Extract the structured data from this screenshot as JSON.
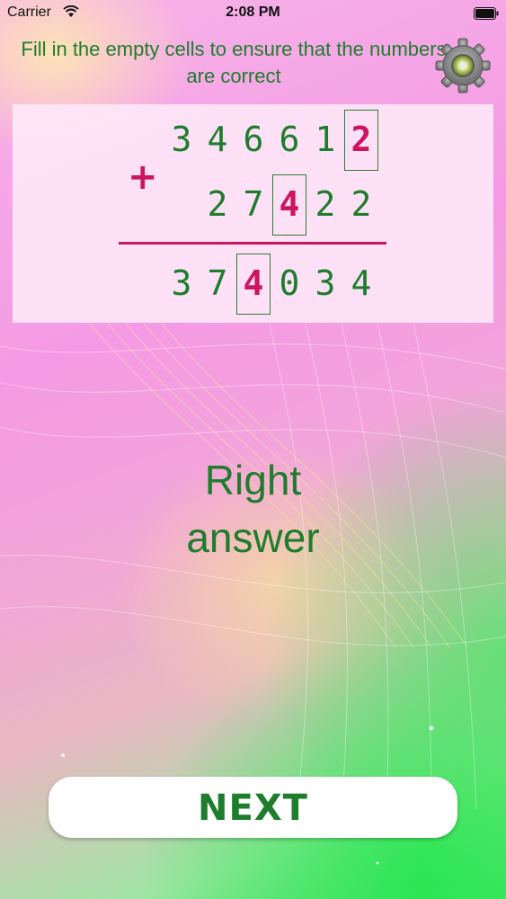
{
  "status_bar": {
    "carrier": "Carrier",
    "time": "2:08 PM",
    "icons": [
      "wifi-icon",
      "battery-icon"
    ]
  },
  "instruction": "Fill in the empty cells to ensure that the numbers are correct",
  "settings": {
    "icon": "gear-icon"
  },
  "puzzle": {
    "operator": "+",
    "addend_1": {
      "digits": [
        "3",
        "4",
        "6",
        "6",
        "1",
        "2"
      ],
      "filled_index": 5
    },
    "addend_2": {
      "digits": [
        "2",
        "7",
        "4",
        "2",
        "2"
      ],
      "filled_index": 2
    },
    "sum": {
      "digits": [
        "3",
        "7",
        "4",
        "0",
        "3",
        "4"
      ],
      "filled_index": 2
    }
  },
  "result": {
    "line_1": "Right",
    "line_2": "answer"
  },
  "next_button": {
    "label": "NEXT"
  },
  "colors": {
    "text_green": "#1e7d2c",
    "filled_red": "#cc1460",
    "panel_pink": "#ffe8f8"
  }
}
